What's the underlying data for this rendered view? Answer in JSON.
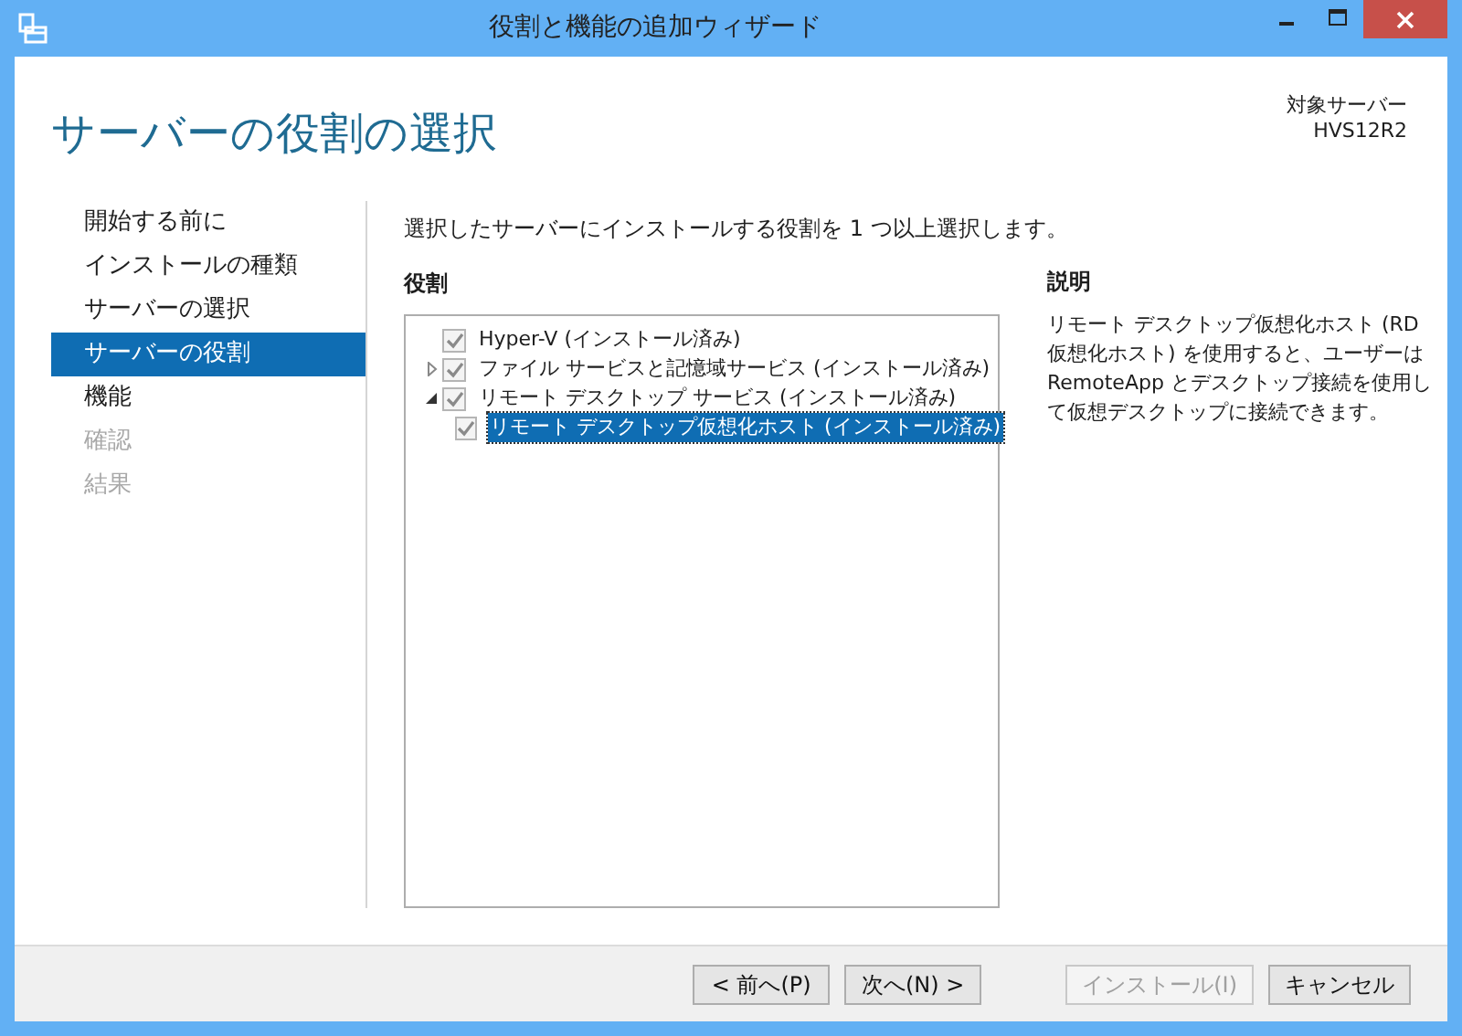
{
  "window": {
    "title": "役割と機能の追加ウィザード"
  },
  "header": {
    "title": "サーバーの役割の選択",
    "target_label": "対象サーバー",
    "target_server": "HVS12R2"
  },
  "steps": [
    {
      "label": "開始する前に",
      "selected": false,
      "disabled": false
    },
    {
      "label": "インストールの種類",
      "selected": false,
      "disabled": false
    },
    {
      "label": "サーバーの選択",
      "selected": false,
      "disabled": false
    },
    {
      "label": "サーバーの役割",
      "selected": true,
      "disabled": false
    },
    {
      "label": "機能",
      "selected": false,
      "disabled": false
    },
    {
      "label": "確認",
      "selected": false,
      "disabled": true
    },
    {
      "label": "結果",
      "selected": false,
      "disabled": true
    }
  ],
  "instruction": "選択したサーバーにインストールする役割を 1 つ以上選択します。",
  "roles": {
    "heading": "役割",
    "items": [
      {
        "label": "Hyper-V (インストール済み)",
        "checked": true,
        "selected": false
      },
      {
        "label": "ファイル サービスと記憶域サービス (インストール済み)",
        "checked": true,
        "selected": false,
        "expanded": false
      },
      {
        "label": "リモート デスクトップ サービス (インストール済み)",
        "checked": true,
        "selected": false,
        "expanded": true,
        "children": [
          {
            "label": "リモート デスクトップ仮想化ホスト (インストール済み)",
            "checked": true,
            "selected": true
          }
        ]
      }
    ]
  },
  "description": {
    "heading": "説明",
    "text": "リモート デスクトップ仮想化ホスト (RD 仮想化ホスト) を使用すると、ユーザーは RemoteApp とデスクトップ接続を使用して仮想デスクトップに接続できます。"
  },
  "buttons": [
    {
      "label": "< 前へ(P)",
      "disabled": false
    },
    {
      "label": "次へ(N) >",
      "disabled": false
    },
    {
      "label": "インストール(I)",
      "disabled": true
    },
    {
      "label": "キャンセル",
      "disabled": false
    }
  ]
}
